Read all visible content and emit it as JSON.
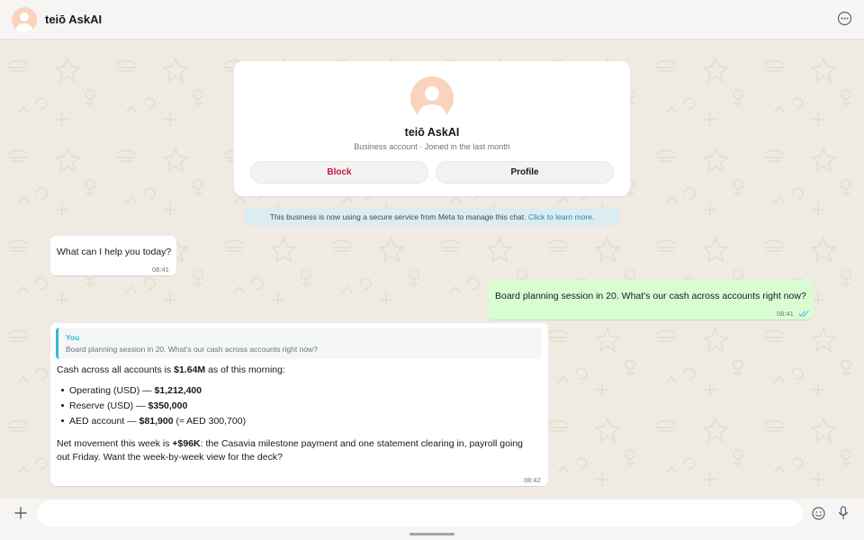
{
  "header": {
    "title": "teiō AskAI"
  },
  "profile_card": {
    "name": "teiō AskAI",
    "subtitle": "Business account · Joined in the last month",
    "block_label": "Block",
    "profile_label": "Profile"
  },
  "notice": {
    "text": "This business is now using a secure service from Meta to manage this chat.",
    "link": "Click to learn more."
  },
  "messages": [
    {
      "direction": "in",
      "text": "What can I help you today?",
      "time": "08:41"
    },
    {
      "direction": "out",
      "text": "Board planning session in 20. What's our cash across accounts right now?",
      "time": "08:41",
      "status": "read"
    },
    {
      "direction": "in",
      "time": "08:42",
      "quote": {
        "author": "You",
        "text": "Board planning session in 20. What's our cash across accounts right now?"
      },
      "intro": {
        "before": "Cash across all accounts is ",
        "bold": "$1.64M",
        "after": " as of this morning:"
      },
      "bullets": [
        {
          "label": "Operating (USD) — ",
          "amount": "$1,212,400",
          "note": ""
        },
        {
          "label": "Reserve (USD) — ",
          "amount": "$350,000",
          "note": ""
        },
        {
          "label": "AED account — ",
          "amount": "$81,900",
          "note": " (≈ AED 300,700)"
        }
      ],
      "closing": {
        "before": "Net movement this week is ",
        "bold": "+$96K",
        "after_line1": ": the Casavia milestone payment and one statement clearing in, payroll going",
        "line2": "out Friday. Want the week-by-week view for the deck?"
      }
    }
  ],
  "composer": {
    "placeholder": ""
  },
  "icons": {
    "header_avatar": "avatar-icon",
    "more": "more-options-icon",
    "plus": "plus-icon",
    "emoji": "emoji-icon",
    "mic": "microphone-icon",
    "read_receipt": "double-check-icon"
  },
  "colors": {
    "chat_background": "#efeae2",
    "outgoing_bubble": "#d9fdd3",
    "block_red": "#c6184a",
    "link_blue": "#1f8ea8",
    "quote_accent": "#35b8d7",
    "read_tick": "#53bdeb"
  }
}
